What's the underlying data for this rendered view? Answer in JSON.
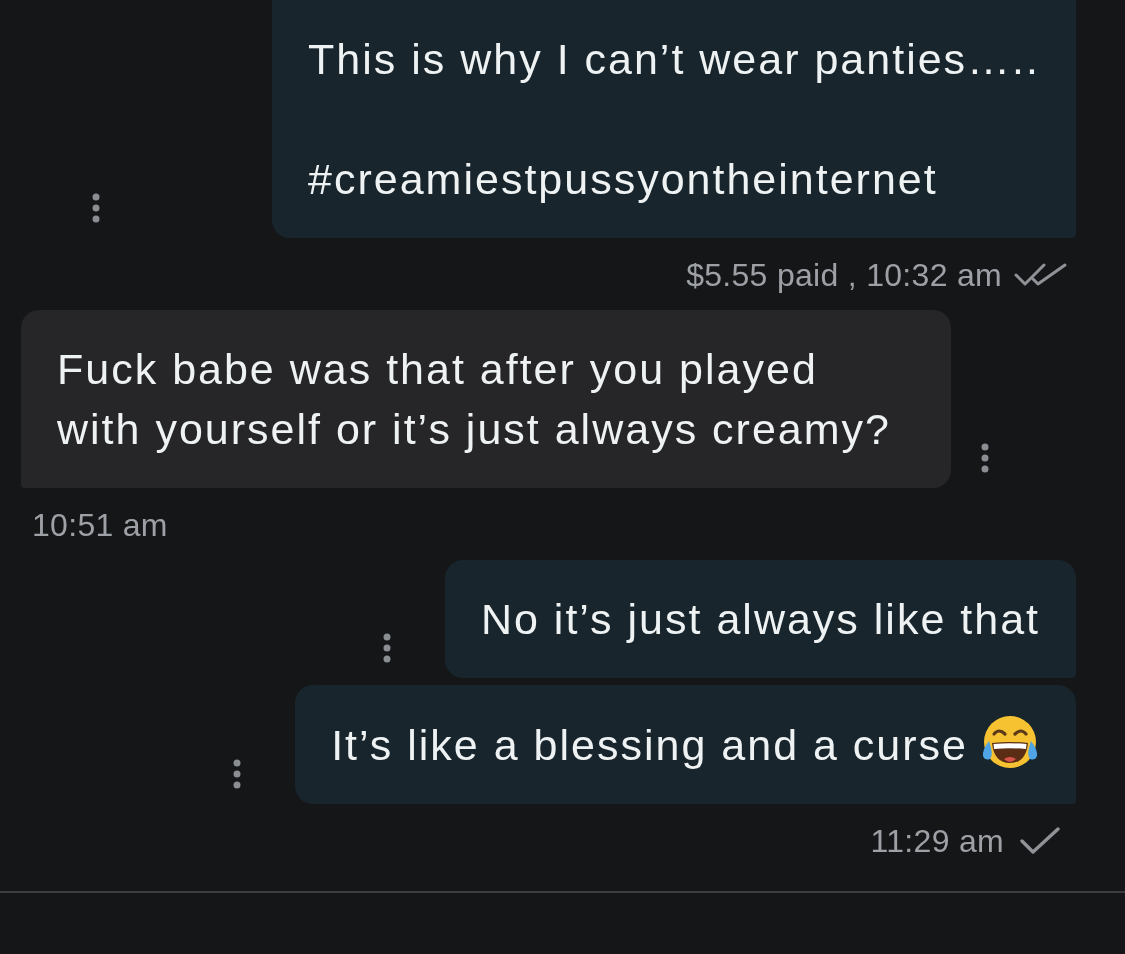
{
  "thread": [
    {
      "kind": "sent",
      "messages": [
        {
          "text": "This is why I can’t wear panties…..\n\n#creamiestpussyontheinternet",
          "emoji": false
        }
      ],
      "footer": {
        "text": "$5.55 paid , 10:32 am",
        "read": true
      }
    },
    {
      "kind": "received",
      "messages": [
        {
          "text": "Fuck babe was that after you played with yourself or it’s just always creamy?",
          "emoji": false
        }
      ],
      "footer": {
        "text": "10:51 am"
      }
    },
    {
      "kind": "sent",
      "messages": [
        {
          "text": "No it’s just always like that",
          "emoji": false
        },
        {
          "text": "It’s like a blessing and a curse",
          "emoji": true
        }
      ],
      "footer": {
        "text": "11:29 am",
        "read": false
      }
    }
  ]
}
